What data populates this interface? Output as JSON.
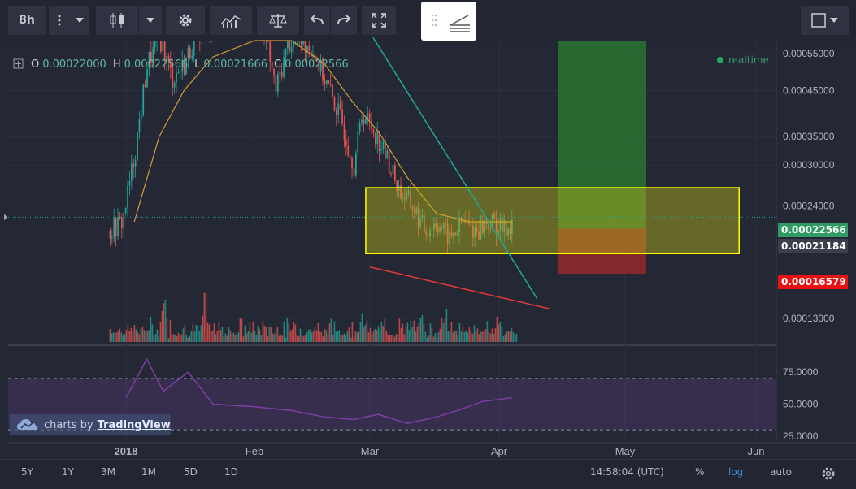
{
  "toolbar": {
    "interval_label": "8h",
    "buttons": [
      "more-icon",
      "dropdown-icon",
      "candles-icon",
      "dropdown-icon",
      "settings-icon",
      "indicators-icon",
      "compare-icon",
      "undo-icon",
      "redo-icon",
      "fullscreen-icon",
      "drawing-toolbar-icon",
      "chart-style-icon"
    ]
  },
  "legend": {
    "o_label": "O",
    "o_value": "0.00022000",
    "h_label": "H",
    "h_value": "0.00022566",
    "l_label": "L",
    "l_value": "0.00021666",
    "c_label": "C",
    "c_value": "0.00022566"
  },
  "status": {
    "realtime": "realtime"
  },
  "price_tags": {
    "last": "0.00022566",
    "level": "0.00021184",
    "stop": "0.00016579"
  },
  "watermark": {
    "prefix": "charts by",
    "brand": "TradingView"
  },
  "bottom": {
    "ranges": [
      "5Y",
      "1Y",
      "3M",
      "1M",
      "5D",
      "1D"
    ],
    "time": "14:58:04 (UTC)",
    "percent": "%",
    "log": "log",
    "auto": "auto"
  },
  "colors": {
    "background": "#1e222d",
    "up": "#26a69a",
    "down": "#ef5350",
    "ma": "#d59b36",
    "box_fill": "#b7b51a",
    "box_border": "#ffff00",
    "target_zone": "#2e7d32",
    "stop_zone": "#c62828",
    "trendline_teal": "#26a69a",
    "trendline_red": "#e53935",
    "rsi": "#7e3fa6",
    "last_price": "#26a69a",
    "stop_price": "#ff0000"
  },
  "chart_data": {
    "type": "candlestick",
    "scale": "log",
    "x_ticks": [
      "2018",
      "Feb",
      "Mar",
      "Apr",
      "May",
      "Jun"
    ],
    "y_ticks": [
      "0.00055000",
      "0.00045000",
      "0.00035000",
      "0.00030000",
      "0.00024000",
      "0.00013000"
    ],
    "ylim": [
      9e-05,
      0.0006
    ],
    "rsi_ticks": [
      "75.0000",
      "50.0000",
      "25.0000"
    ],
    "rsi_levels": [
      70,
      30
    ],
    "price_path": [
      [
        "2017-12-28",
        0.00021
      ],
      [
        "2017-12-31",
        0.00022
      ],
      [
        "2018-01-03",
        0.00032
      ],
      [
        "2018-01-06",
        0.00052
      ],
      [
        "2018-01-09",
        0.0006
      ],
      [
        "2018-01-12",
        0.00048
      ],
      [
        "2018-01-15",
        0.00052
      ],
      [
        "2018-01-18",
        0.00062
      ],
      [
        "2018-01-22",
        0.00065
      ],
      [
        "2018-01-26",
        0.00066
      ],
      [
        "2018-01-30",
        0.00068
      ],
      [
        "2018-02-03",
        0.00064
      ],
      [
        "2018-02-06",
        0.00045
      ],
      [
        "2018-02-09",
        0.00058
      ],
      [
        "2018-02-12",
        0.0006
      ],
      [
        "2018-02-15",
        0.00056
      ],
      [
        "2018-02-19",
        0.00045
      ],
      [
        "2018-02-22",
        0.00038
      ],
      [
        "2018-02-25",
        0.0003
      ],
      [
        "2018-02-27",
        0.0004
      ],
      [
        "2018-03-02",
        0.00036
      ],
      [
        "2018-03-05",
        0.00031
      ],
      [
        "2018-03-08",
        0.00026
      ],
      [
        "2018-03-11",
        0.00024
      ],
      [
        "2018-03-14",
        0.00021
      ],
      [
        "2018-03-17",
        0.00022
      ],
      [
        "2018-03-20",
        0.0002
      ],
      [
        "2018-03-23",
        0.00022
      ],
      [
        "2018-03-26",
        0.00021
      ],
      [
        "2018-03-30",
        0.00022
      ],
      [
        "2018-04-02",
        0.00021
      ],
      [
        "2018-04-04",
        0.00022
      ]
    ],
    "ma_path": [
      [
        "2018-01-03",
        0.00022
      ],
      [
        "2018-01-09",
        0.00035
      ],
      [
        "2018-01-15",
        0.00045
      ],
      [
        "2018-01-22",
        0.00054
      ],
      [
        "2018-02-01",
        0.00061
      ],
      [
        "2018-02-10",
        0.0006
      ],
      [
        "2018-02-18",
        0.00052
      ],
      [
        "2018-02-25",
        0.00042
      ],
      [
        "2018-03-03",
        0.00036
      ],
      [
        "2018-03-10",
        0.00028
      ],
      [
        "2018-03-17",
        0.00023
      ],
      [
        "2018-03-25",
        0.00022
      ],
      [
        "2018-04-04",
        0.00022
      ]
    ],
    "volume_peaks": [
      [
        "2018-01-10",
        0.9
      ],
      [
        "2018-01-20",
        1.0
      ],
      [
        "2018-02-27",
        0.6
      ],
      [
        "2018-03-13",
        0.7
      ],
      [
        "2018-03-19",
        0.6
      ],
      [
        "2018-03-29",
        0.3
      ]
    ],
    "rsi_path": [
      [
        "2018-01-01",
        55
      ],
      [
        "2018-01-06",
        85
      ],
      [
        "2018-01-10",
        60
      ],
      [
        "2018-01-16",
        75
      ],
      [
        "2018-01-22",
        50
      ],
      [
        "2018-02-01",
        48
      ],
      [
        "2018-02-10",
        45
      ],
      [
        "2018-02-18",
        40
      ],
      [
        "2018-02-25",
        38
      ],
      [
        "2018-03-03",
        42
      ],
      [
        "2018-03-10",
        35
      ],
      [
        "2018-03-17",
        40
      ],
      [
        "2018-03-22",
        45
      ],
      [
        "2018-03-28",
        52
      ],
      [
        "2018-04-04",
        55
      ]
    ],
    "annotations": {
      "range_box": {
        "from": "2018-02-28",
        "to": "2018-05-28",
        "top": 0.000265,
        "bottom": 0.000185
      },
      "target_zone": {
        "from": "2018-04-15",
        "to": "2018-05-06",
        "top": 0.0006,
        "bottom": 0.00021184
      },
      "stop_zone": {
        "from": "2018-04-15",
        "to": "2018-05-06",
        "top": 0.00021184,
        "bottom": 0.00016579
      },
      "teal_trendline": {
        "from": [
          "2018-02-14",
          0.0006
        ],
        "to": [
          "2018-04-10",
          0.000145
        ]
      },
      "red_trendline": {
        "from": [
          "2018-03-01",
          0.000172
        ],
        "to": [
          "2018-04-13",
          0.000137
        ]
      },
      "last_price": 0.00022566
    }
  }
}
